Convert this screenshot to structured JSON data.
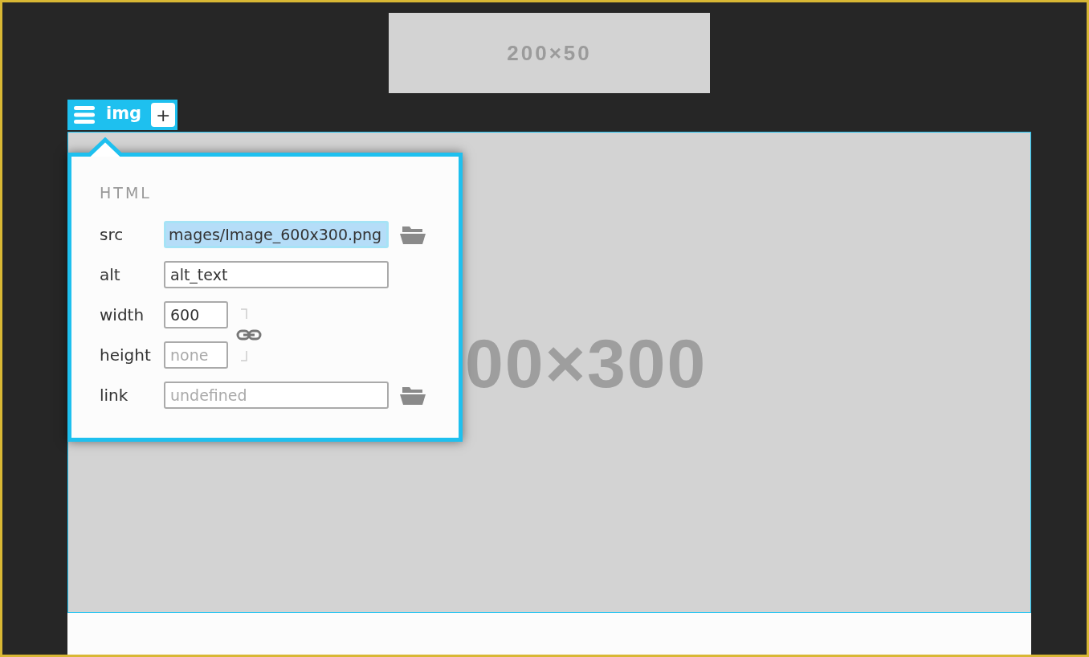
{
  "top_image": {
    "label": "200×50"
  },
  "element_toolbar": {
    "tag": "img",
    "add_button": "+"
  },
  "main_image": {
    "label": "00×300"
  },
  "properties_panel": {
    "section": "HTML",
    "fields": [
      {
        "label": "src",
        "kind": "file",
        "value": "mages/Image_600x300.png",
        "focused": true
      },
      {
        "label": "alt",
        "kind": "text",
        "value": "alt_text",
        "focused": false
      },
      {
        "label": "width",
        "kind": "size",
        "value": "600",
        "focused": false
      },
      {
        "label": "height",
        "kind": "size",
        "placeholder": "none",
        "focused": false
      },
      {
        "label": "link",
        "kind": "file",
        "placeholder": "undefined",
        "focused": false
      }
    ]
  }
}
